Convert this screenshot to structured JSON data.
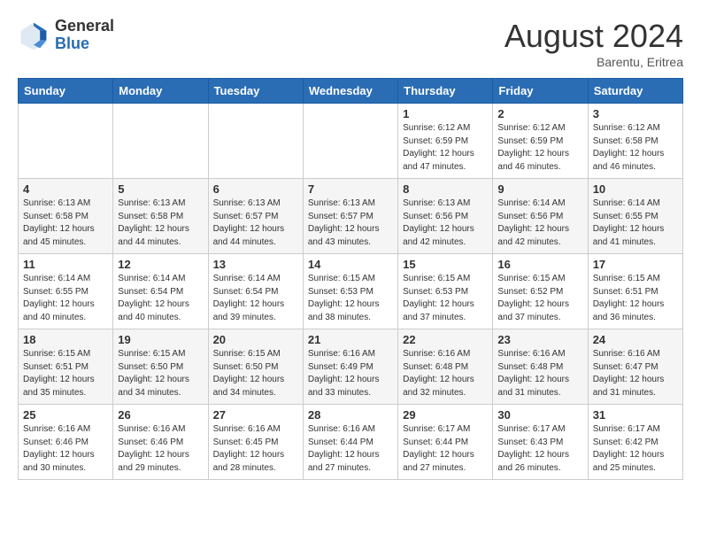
{
  "header": {
    "logo_general": "General",
    "logo_blue": "Blue",
    "month_year": "August 2024",
    "location": "Barentu, Eritrea"
  },
  "days_of_week": [
    "Sunday",
    "Monday",
    "Tuesday",
    "Wednesday",
    "Thursday",
    "Friday",
    "Saturday"
  ],
  "weeks": [
    [
      {
        "day": "",
        "info": ""
      },
      {
        "day": "",
        "info": ""
      },
      {
        "day": "",
        "info": ""
      },
      {
        "day": "",
        "info": ""
      },
      {
        "day": "1",
        "info": "Sunrise: 6:12 AM\nSunset: 6:59 PM\nDaylight: 12 hours and 47 minutes."
      },
      {
        "day": "2",
        "info": "Sunrise: 6:12 AM\nSunset: 6:59 PM\nDaylight: 12 hours and 46 minutes."
      },
      {
        "day": "3",
        "info": "Sunrise: 6:12 AM\nSunset: 6:58 PM\nDaylight: 12 hours and 46 minutes."
      }
    ],
    [
      {
        "day": "4",
        "info": "Sunrise: 6:13 AM\nSunset: 6:58 PM\nDaylight: 12 hours and 45 minutes."
      },
      {
        "day": "5",
        "info": "Sunrise: 6:13 AM\nSunset: 6:58 PM\nDaylight: 12 hours and 44 minutes."
      },
      {
        "day": "6",
        "info": "Sunrise: 6:13 AM\nSunset: 6:57 PM\nDaylight: 12 hours and 44 minutes."
      },
      {
        "day": "7",
        "info": "Sunrise: 6:13 AM\nSunset: 6:57 PM\nDaylight: 12 hours and 43 minutes."
      },
      {
        "day": "8",
        "info": "Sunrise: 6:13 AM\nSunset: 6:56 PM\nDaylight: 12 hours and 42 minutes."
      },
      {
        "day": "9",
        "info": "Sunrise: 6:14 AM\nSunset: 6:56 PM\nDaylight: 12 hours and 42 minutes."
      },
      {
        "day": "10",
        "info": "Sunrise: 6:14 AM\nSunset: 6:55 PM\nDaylight: 12 hours and 41 minutes."
      }
    ],
    [
      {
        "day": "11",
        "info": "Sunrise: 6:14 AM\nSunset: 6:55 PM\nDaylight: 12 hours and 40 minutes."
      },
      {
        "day": "12",
        "info": "Sunrise: 6:14 AM\nSunset: 6:54 PM\nDaylight: 12 hours and 40 minutes."
      },
      {
        "day": "13",
        "info": "Sunrise: 6:14 AM\nSunset: 6:54 PM\nDaylight: 12 hours and 39 minutes."
      },
      {
        "day": "14",
        "info": "Sunrise: 6:15 AM\nSunset: 6:53 PM\nDaylight: 12 hours and 38 minutes."
      },
      {
        "day": "15",
        "info": "Sunrise: 6:15 AM\nSunset: 6:53 PM\nDaylight: 12 hours and 37 minutes."
      },
      {
        "day": "16",
        "info": "Sunrise: 6:15 AM\nSunset: 6:52 PM\nDaylight: 12 hours and 37 minutes."
      },
      {
        "day": "17",
        "info": "Sunrise: 6:15 AM\nSunset: 6:51 PM\nDaylight: 12 hours and 36 minutes."
      }
    ],
    [
      {
        "day": "18",
        "info": "Sunrise: 6:15 AM\nSunset: 6:51 PM\nDaylight: 12 hours and 35 minutes."
      },
      {
        "day": "19",
        "info": "Sunrise: 6:15 AM\nSunset: 6:50 PM\nDaylight: 12 hours and 34 minutes."
      },
      {
        "day": "20",
        "info": "Sunrise: 6:15 AM\nSunset: 6:50 PM\nDaylight: 12 hours and 34 minutes."
      },
      {
        "day": "21",
        "info": "Sunrise: 6:16 AM\nSunset: 6:49 PM\nDaylight: 12 hours and 33 minutes."
      },
      {
        "day": "22",
        "info": "Sunrise: 6:16 AM\nSunset: 6:48 PM\nDaylight: 12 hours and 32 minutes."
      },
      {
        "day": "23",
        "info": "Sunrise: 6:16 AM\nSunset: 6:48 PM\nDaylight: 12 hours and 31 minutes."
      },
      {
        "day": "24",
        "info": "Sunrise: 6:16 AM\nSunset: 6:47 PM\nDaylight: 12 hours and 31 minutes."
      }
    ],
    [
      {
        "day": "25",
        "info": "Sunrise: 6:16 AM\nSunset: 6:46 PM\nDaylight: 12 hours and 30 minutes."
      },
      {
        "day": "26",
        "info": "Sunrise: 6:16 AM\nSunset: 6:46 PM\nDaylight: 12 hours and 29 minutes."
      },
      {
        "day": "27",
        "info": "Sunrise: 6:16 AM\nSunset: 6:45 PM\nDaylight: 12 hours and 28 minutes."
      },
      {
        "day": "28",
        "info": "Sunrise: 6:16 AM\nSunset: 6:44 PM\nDaylight: 12 hours and 27 minutes."
      },
      {
        "day": "29",
        "info": "Sunrise: 6:17 AM\nSunset: 6:44 PM\nDaylight: 12 hours and 27 minutes."
      },
      {
        "day": "30",
        "info": "Sunrise: 6:17 AM\nSunset: 6:43 PM\nDaylight: 12 hours and 26 minutes."
      },
      {
        "day": "31",
        "info": "Sunrise: 6:17 AM\nSunset: 6:42 PM\nDaylight: 12 hours and 25 minutes."
      }
    ]
  ]
}
